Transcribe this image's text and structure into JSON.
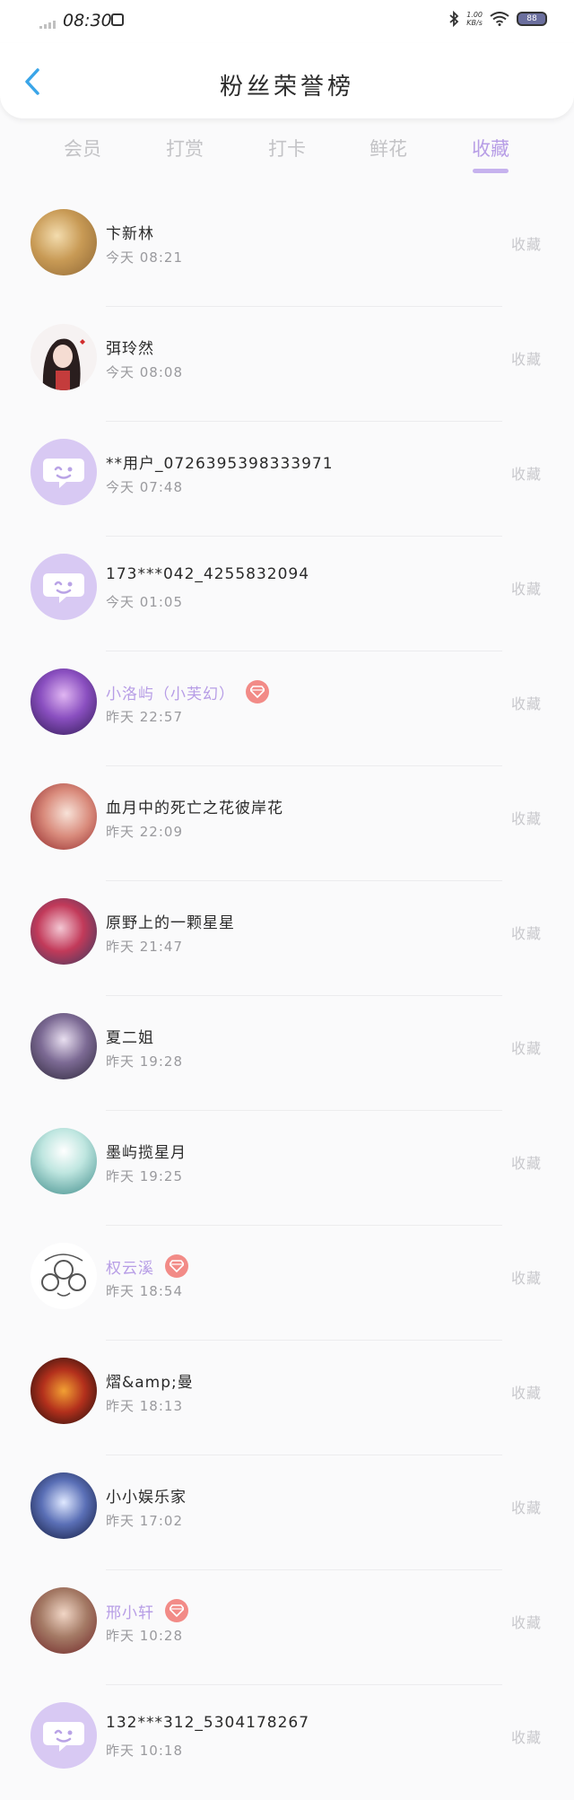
{
  "status_bar": {
    "time": "08:30",
    "net_speed_value": "1.00",
    "net_speed_unit": "KB/s",
    "battery": "88"
  },
  "nav": {
    "title": "粉丝荣誉榜"
  },
  "tabs": [
    {
      "label": "会员",
      "active": false
    },
    {
      "label": "打赏",
      "active": false
    },
    {
      "label": "打卡",
      "active": false
    },
    {
      "label": "鲜花",
      "active": false
    },
    {
      "label": "收藏",
      "active": true
    }
  ],
  "action_label": "收藏",
  "colors": {
    "accent": "#b79de6",
    "badge": "#f28b87",
    "muted": "#c8c8cc"
  },
  "fans": [
    {
      "name": "卞新林",
      "time": "今天 08:21",
      "vip": false,
      "avatar": "avatar-gold-fabric"
    },
    {
      "name": "弭玲然",
      "time": "今天 08:08",
      "vip": false,
      "avatar": "avatar-anime-girl"
    },
    {
      "name": "**用户_0726395398333971",
      "time": "今天 07:48",
      "vip": false,
      "avatar": "avatar-default"
    },
    {
      "name": "173***042_4255832094",
      "time": "今天 01:05",
      "vip": false,
      "avatar": "avatar-default"
    },
    {
      "name": "小洛屿（小芙幻）",
      "time": "昨天 22:57",
      "vip": true,
      "avatar": "avatar-purple-fantasy"
    },
    {
      "name": "血月中的死亡之花彼岸花",
      "time": "昨天 22:09",
      "vip": false,
      "avatar": "avatar-red-flower"
    },
    {
      "name": "原野上的一颗星星",
      "time": "昨天 21:47",
      "vip": false,
      "avatar": "avatar-pink-hair"
    },
    {
      "name": "夏二姐",
      "time": "昨天 19:28",
      "vip": false,
      "avatar": "avatar-dark-purple"
    },
    {
      "name": "墨屿揽星月",
      "time": "昨天 19:25",
      "vip": false,
      "avatar": "avatar-teal-girl"
    },
    {
      "name": "权云溪",
      "time": "昨天 18:54",
      "vip": true,
      "avatar": "avatar-sketch"
    },
    {
      "name": "熠&amp;曼",
      "time": "昨天 18:13",
      "vip": false,
      "avatar": "avatar-red-dark"
    },
    {
      "name": "小小娱乐家",
      "time": "昨天 17:02",
      "vip": false,
      "avatar": "avatar-blue-night"
    },
    {
      "name": "邢小轩",
      "time": "昨天 10:28",
      "vip": true,
      "avatar": "avatar-boy-photo"
    },
    {
      "name": "132***312_5304178267",
      "time": "昨天 10:18",
      "vip": false,
      "avatar": "avatar-default"
    }
  ]
}
